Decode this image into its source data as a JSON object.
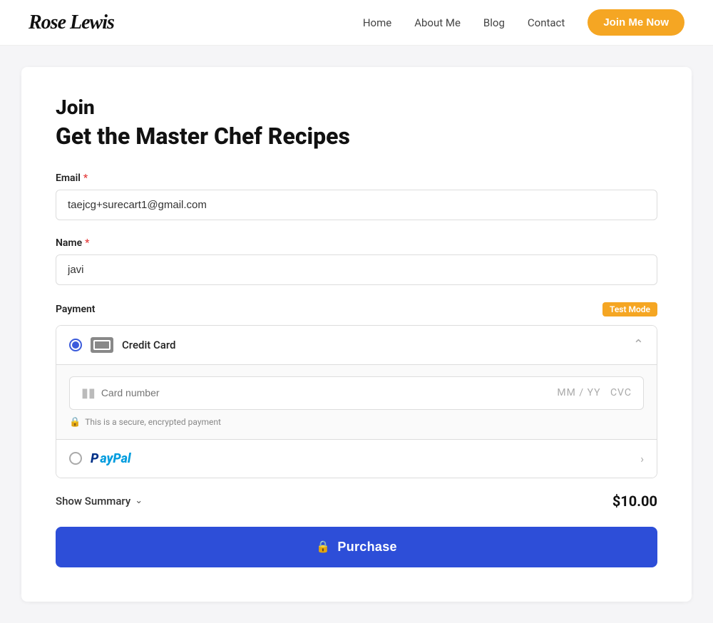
{
  "nav": {
    "logo": "Rose Lewis",
    "links": [
      {
        "label": "Home",
        "id": "home"
      },
      {
        "label": "About Me",
        "id": "about"
      },
      {
        "label": "Blog",
        "id": "blog"
      },
      {
        "label": "Contact",
        "id": "contact"
      }
    ],
    "cta_label": "Join Me Now"
  },
  "form": {
    "join_label": "Join",
    "product_title": "Get the Master Chef Recipes",
    "email_label": "Email",
    "email_value": "taejcg+surecart1@gmail.com",
    "email_placeholder": "taejcg+surecart1@gmail.com",
    "name_label": "Name",
    "name_value": "javi",
    "name_placeholder": "javi",
    "payment_label": "Payment",
    "test_mode_label": "Test Mode",
    "credit_card_label": "Credit Card",
    "card_number_placeholder": "Card number",
    "card_expiry_placeholder": "MM / YY",
    "card_cvc_placeholder": "CVC",
    "secure_notice": "This is a secure, encrypted payment",
    "paypal_label": "PayPal",
    "show_summary_label": "Show Summary",
    "price": "$10.00",
    "purchase_label": "Purchase"
  }
}
